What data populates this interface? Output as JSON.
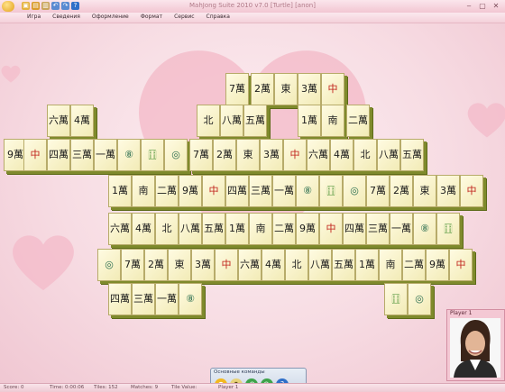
{
  "window": {
    "title": "MahJong Suite 2010 v7.0  [Turtle]  [anon]",
    "controls": [
      "‒",
      "▢",
      "✕"
    ]
  },
  "quick_access": [
    "folder-icon",
    "save-icon",
    "print-icon",
    "undo-icon",
    "redo-icon",
    "help-icon"
  ],
  "menu": [
    "Игра",
    "Сведения",
    "Оформление",
    "Формат",
    "Сервис",
    "Справка"
  ],
  "tiles": [
    {
      "type": "char",
      "label": "7萬"
    },
    {
      "type": "char",
      "label": "2萬"
    },
    {
      "type": "wind",
      "label": "東"
    },
    {
      "type": "char",
      "label": "3萬"
    },
    {
      "type": "drg",
      "label": "中"
    },
    {
      "type": "char",
      "label": "六萬"
    },
    {
      "type": "char",
      "label": "4萬"
    },
    {
      "type": "wind",
      "label": "北"
    },
    {
      "type": "char",
      "label": "八萬"
    },
    {
      "type": "char",
      "label": "五萬"
    },
    {
      "type": "char",
      "label": "1萬"
    },
    {
      "type": "wind",
      "label": "南"
    },
    {
      "type": "char",
      "label": "二萬"
    },
    {
      "type": "char",
      "label": "9萬"
    },
    {
      "type": "drg",
      "label": "中"
    },
    {
      "type": "char",
      "label": "四萬"
    },
    {
      "type": "char",
      "label": "三萬"
    },
    {
      "type": "char",
      "label": "一萬"
    },
    {
      "type": "dot",
      "label": "⑧"
    },
    {
      "type": "bam",
      "label": "🀓"
    },
    {
      "type": "dot",
      "label": "◎"
    }
  ],
  "toolbar": {
    "title": "Основные команды",
    "buttons": [
      "hint-icon",
      "shuffle-icon",
      "undo-icon",
      "redo-icon",
      "help-icon"
    ]
  },
  "player": {
    "label": "Player 1"
  },
  "status": {
    "score": "Score: 0",
    "time": "Time: 0:00:06",
    "tiles": "Tiles: 152",
    "matches": "Matches: 9",
    "tile_value": "Tile Value:",
    "player": "Player 1"
  },
  "colors": {
    "accent": "#f2c6d2",
    "tile": "#f7f0c4",
    "tile_edge": "#7f8a2c"
  }
}
